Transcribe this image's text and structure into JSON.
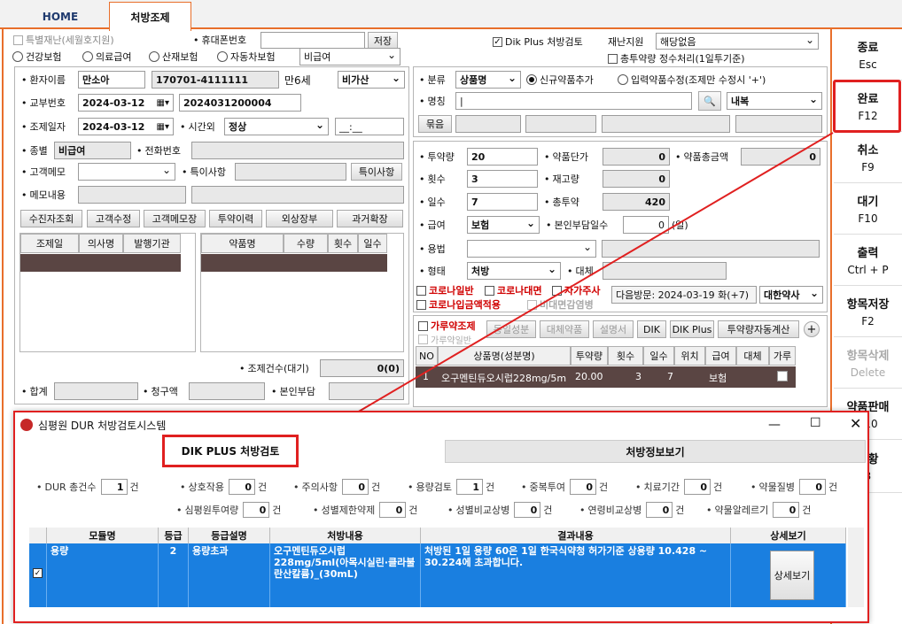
{
  "tabs": {
    "home": "HOME",
    "active": "처방조제"
  },
  "top": {
    "special": "특별재난(세월호지원)",
    "phone_label": "휴대폰번호",
    "save": "저장",
    "dik_check": "Dik Plus 처방검토",
    "disaster_label": "재난지원",
    "disaster_value": "해당없음",
    "total_cap": "총투약량 정수처리(1일투기준)",
    "ins1": "건강보험",
    "ins2": "의료급여",
    "ins3": "산재보험",
    "ins4": "자동차보험",
    "pay_sel": "비급여"
  },
  "patient": {
    "name_label": "환자이름",
    "name": "만소아",
    "id": "170701-4111111",
    "age": "만6세",
    "tax": "비가산",
    "lot_label": "교부번호",
    "date1": "2024-03-12",
    "lot": "2024031200004",
    "rx_label": "조제일자",
    "date2": "2024-03-12",
    "time_label": "시간외",
    "time_value": "정상",
    "time_input": "__:__",
    "kind_label": "종별",
    "kind": "비급여",
    "tel_label": "전화번호",
    "memo_label": "고객메모",
    "special_label": "특이사항",
    "special_btn": "특이사항",
    "memo2_label": "메모내용"
  },
  "btns": [
    "수진자조회",
    "고객수정",
    "고객메모장",
    "투약이력",
    "외상장부",
    "과거확장"
  ],
  "hist_cols": [
    "조제일",
    "의사명",
    "발행기관"
  ],
  "drug_cols": [
    "약품명",
    "수량",
    "횟수",
    "일수"
  ],
  "summary": {
    "count_label": "조제건수(대기)",
    "count": "0(0)",
    "total": "합계",
    "claim": "청구액",
    "self": "본인부담"
  },
  "drug": {
    "cat_label": "분류",
    "cat": "상품명",
    "new": "신규약품추가",
    "edit": "입력약품수정(조제만 수정시 '+')",
    "name_label": "명칭",
    "route": "내복",
    "bundle": "묶음",
    "qty_label": "투약량",
    "qty": "20",
    "unit_label": "약품단가",
    "unit": "0",
    "sum_label": "약품총금액",
    "sum": "0",
    "times_label": "횟수",
    "times": "3",
    "stock_label": "재고량",
    "stock": "0",
    "days_label": "일수",
    "days": "7",
    "total_label": "총투약",
    "total": "420",
    "pay_label": "급여",
    "pay": "보험",
    "self_days": "본인부담일수",
    "self_days_v": "0",
    "self_unit": "(일)",
    "usage_label": "용법",
    "form_label": "형태",
    "form": "처방",
    "sub_label": "대체",
    "c1": "코로나일반",
    "c2": "코로나대면",
    "c3": "자가주사",
    "c4": "코로나입금액적용",
    "c5": "비대면감염병",
    "next": "다음방문: 2024-03-19 화(+7)",
    "pharm": "대한약사"
  },
  "rxbar": {
    "powder": "가루약조제",
    "powder2": "가루약일반",
    "b1": "동일성분",
    "b2": "대체약품",
    "b3": "설명서",
    "b4": "DIK",
    "b5": "DIK Plus",
    "b6": "투약량자동계산"
  },
  "rx_cols": [
    "NO",
    "상품명(성분명)",
    "투약량",
    "횟수",
    "일수",
    "위치",
    "급여",
    "대체",
    "가루"
  ],
  "rx_row": {
    "no": "1",
    "name": "오구멘틴듀오시럽228mg/5m",
    "qty": "20.00",
    "times": "3",
    "days": "7",
    "pay": "보험"
  },
  "side": [
    {
      "t": "종료",
      "k": "Esc"
    },
    {
      "t": "완료",
      "k": "F12"
    },
    {
      "t": "취소",
      "k": "F9"
    },
    {
      "t": "대기",
      "k": "F10"
    },
    {
      "t": "출력",
      "k": "Ctrl + P"
    },
    {
      "t": "항목저장",
      "k": "F2"
    },
    {
      "t": "항목삭제",
      "k": "Delete"
    },
    {
      "t": "약품판매",
      "k": "F10"
    },
    {
      "t": "현황",
      "k": "3"
    }
  ],
  "dur": {
    "title": "심평원 DUR 처방검토시스템",
    "tab1": "DIK PLUS 처방검토",
    "tab2": "처방정보보기",
    "unit": "건",
    "counts": [
      {
        "l": "DUR 총건수",
        "v": "1"
      },
      {
        "l": "상호작용",
        "v": "0"
      },
      {
        "l": "주의사항",
        "v": "0"
      },
      {
        "l": "용량검토",
        "v": "1"
      },
      {
        "l": "중복투여",
        "v": "0"
      },
      {
        "l": "치료기간",
        "v": "0"
      },
      {
        "l": "약물질병",
        "v": "0"
      },
      {
        "l": "심평원투여량",
        "v": "0"
      },
      {
        "l": "성별제한약제",
        "v": "0"
      },
      {
        "l": "성별비교상병",
        "v": "0"
      },
      {
        "l": "연령비교상병",
        "v": "0"
      },
      {
        "l": "약물알레르기",
        "v": "0"
      }
    ],
    "cols": [
      "모듈명",
      "등급",
      "등급설명",
      "처방내용",
      "결과내용",
      "상세보기"
    ],
    "row": {
      "module": "용량",
      "grade": "2",
      "desc": "용량초과",
      "content": "오구멘틴듀오시럽 228mg/5ml(아목시실린·클라불란산칼륨)_(30mL)",
      "result": "처방된 1일 용량 60은 1일 한국식약청 허가기준 상용량 10.428 ~ 30.224에 초과합니다.",
      "detail": "상세보기"
    }
  }
}
